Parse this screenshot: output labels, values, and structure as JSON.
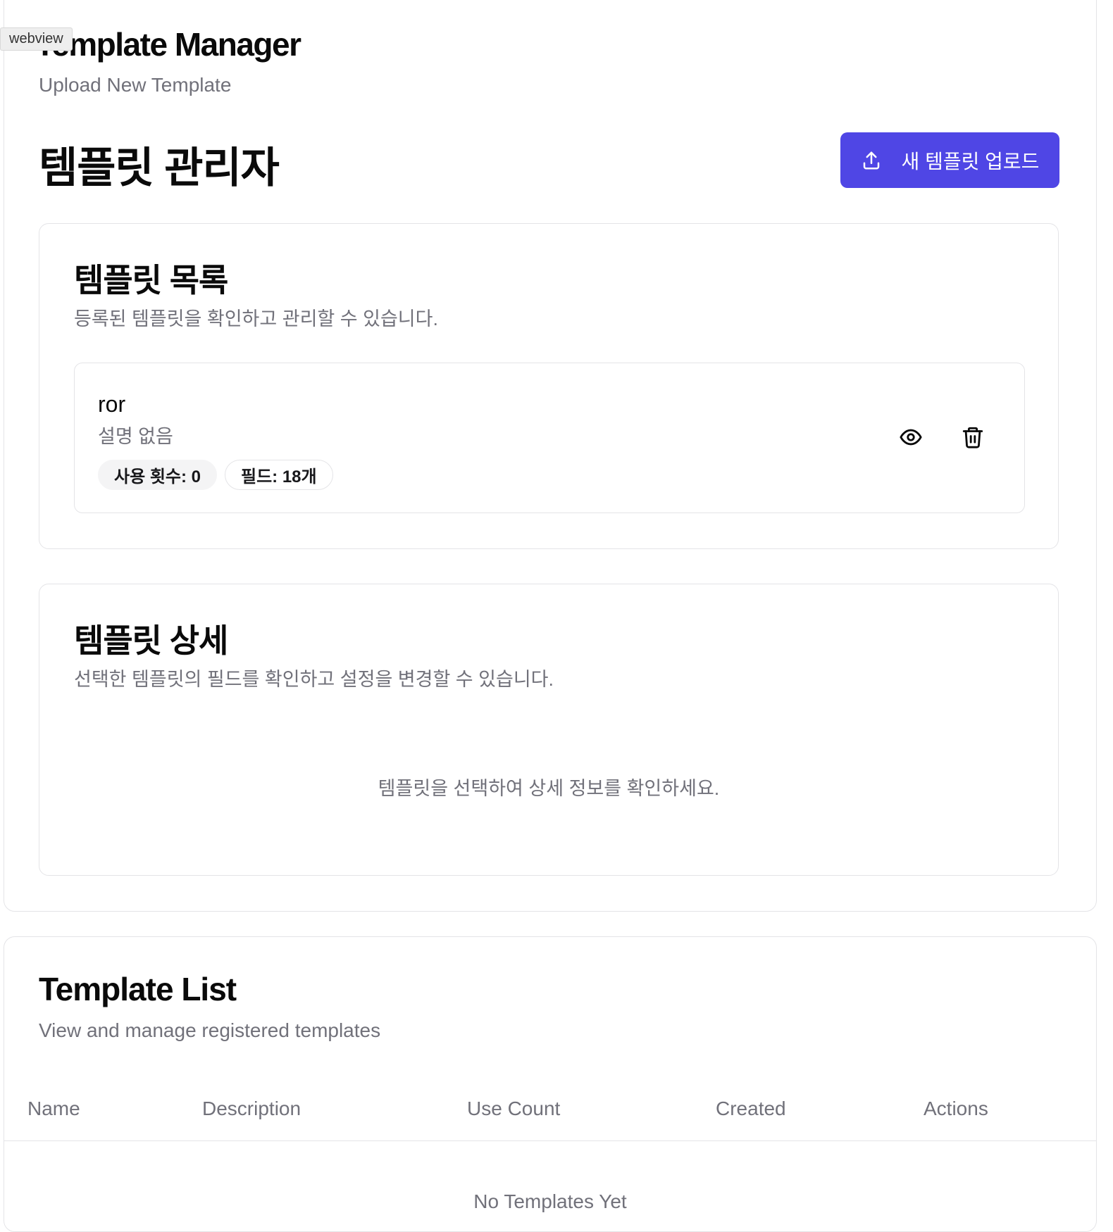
{
  "webview_label": "webview",
  "app": {
    "title": "Template Manager",
    "subtitle": "Upload New Template"
  },
  "page": {
    "title": "템플릿 관리자",
    "upload_button_label": "새 템플릿 업로드",
    "accent_color": "#4f46e5"
  },
  "template_list_card": {
    "title": "템플릿 목록",
    "description": "등록된 템플릿을 확인하고 관리할 수 있습니다.",
    "items": [
      {
        "name": "ror",
        "description": "설명 없음",
        "usage_badge": "사용 횟수: 0",
        "fields_badge": "필드: 18개"
      }
    ]
  },
  "template_detail_card": {
    "title": "템플릿 상세",
    "description": "선택한 템플릿의 필드를 확인하고 설정을 변경할 수 있습니다.",
    "empty_message": "템플릿을 선택하여 상세 정보를 확인하세요."
  },
  "template_list_section": {
    "title": "Template List",
    "description": "View and manage registered templates",
    "columns": [
      "Name",
      "Description",
      "Use Count",
      "Created",
      "Actions"
    ],
    "empty_message": "No Templates Yet"
  },
  "icons": {
    "upload": "upload-icon",
    "view": "eye-icon",
    "delete": "trash-icon"
  }
}
